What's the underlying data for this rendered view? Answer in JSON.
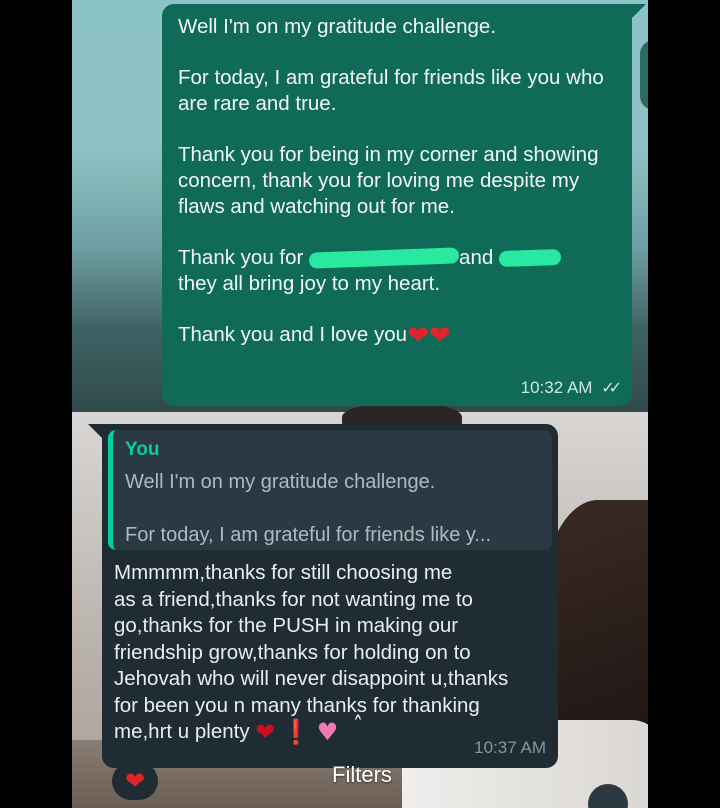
{
  "outgoing_message": {
    "paragraphs": [
      "Well I'm on my gratitude challenge.",
      "For today, I am grateful for friends like you who are rare and true.",
      "Thank you for being in my corner and showing concern, thank you for loving me despite my flaws and watching out for me."
    ],
    "thanks_prefix": "Thank you for",
    "thanks_and": "and",
    "thanks_suffix": "they all bring joy to my heart.",
    "closing": "Thank you and I love you",
    "closing_emojis": "❤❤",
    "time": "10:32 AM",
    "status_icon": "double-check-icon",
    "status_glyph": "✓✓"
  },
  "incoming_message": {
    "quote": {
      "author": "You",
      "line1": "Well I'm on my gratitude challenge.",
      "line2": "For today, I am grateful for friends like y..."
    },
    "lines": [
      "Mmmmm,thanks for still choosing me",
      "as a friend,thanks for not wanting me to",
      "go,thanks for the PUSH in making our",
      "friendship grow,thanks for holding on to",
      "Jehovah who will never disappoint u,thanks",
      "for been you n many thanks for thanking"
    ],
    "last_line": "me,hrt u plenty",
    "emojis": {
      "heart": "❤",
      "exclamation": "❗",
      "sparkle_heart": "♥"
    },
    "time": "10:37 AM",
    "reaction": "❤"
  },
  "overlay": {
    "chevron_glyph": "˄",
    "filters_label": "Filters"
  },
  "colors": {
    "outgoing_bubble": "#0f6b57",
    "incoming_bubble": "#1f2c33",
    "quote_accent": "#06cf9c",
    "redaction": "#29e8a0"
  }
}
